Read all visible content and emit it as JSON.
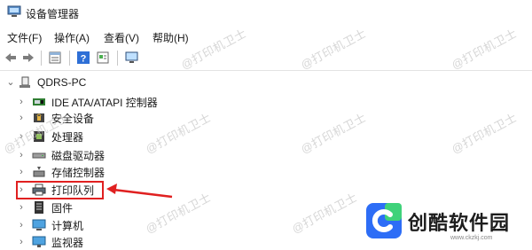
{
  "window": {
    "title": "设备管理器"
  },
  "menu": [
    {
      "label": "文件(F)"
    },
    {
      "label": "操作(A)"
    },
    {
      "label": "查看(V)"
    },
    {
      "label": "帮助(H)"
    }
  ],
  "tree": {
    "root": {
      "label": "QDRS-PC"
    },
    "items": [
      {
        "label": "IDE ATA/ATAPI 控制器",
        "icon": "ide-controller-icon"
      },
      {
        "label": "安全设备",
        "icon": "security-device-icon"
      },
      {
        "label": "处理器",
        "icon": "processor-icon"
      },
      {
        "label": "磁盘驱动器",
        "icon": "disk-drive-icon"
      },
      {
        "label": "存储控制器",
        "icon": "storage-controller-icon"
      },
      {
        "label": "打印队列",
        "icon": "printer-icon"
      },
      {
        "label": "固件",
        "icon": "firmware-icon"
      },
      {
        "label": "计算机",
        "icon": "computer-icon"
      },
      {
        "label": "监视器",
        "icon": "monitor-icon"
      }
    ]
  },
  "watermark": {
    "text": "@打印机卫士"
  },
  "brand": {
    "name": "创酷软件园",
    "url": "www.ckzkj.com"
  },
  "colors": {
    "highlight": "#e02020",
    "accent": "#2e6fd6"
  }
}
